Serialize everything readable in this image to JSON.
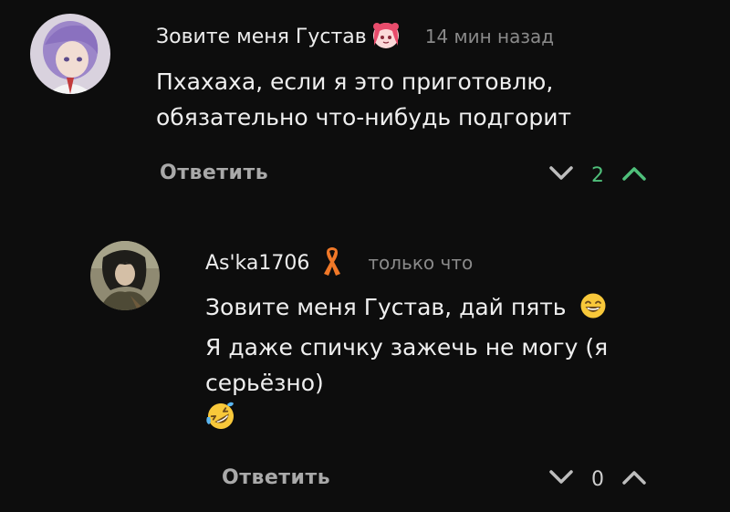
{
  "colors": {
    "background": "#0d0d0d",
    "text_primary": "#efefef",
    "text_muted": "#8a8a8a",
    "score_positive": "#4fbf7a",
    "score_neutral": "#cfcfcf",
    "icon_muted": "#bdbdbd"
  },
  "comments": [
    {
      "username": "Зовите меня Густав",
      "badge_icon": "anime-girl-badge-icon",
      "timestamp": "14 мин назад",
      "body_lines": [
        "Пхахаха, если я это приготовлю,",
        "обязательно что-нибудь подгорит"
      ],
      "reply_label": "Ответить",
      "score": "2"
    },
    {
      "username": "As'ka1706",
      "badge_icon": "awareness-ribbon-icon",
      "timestamp": "только что",
      "body_lines": [
        "Зовите меня Густав, дай пять",
        "Я даже спичку зажечь не могу (я",
        "серьёзно)"
      ],
      "emoji_inline": "grinning-face-emoji",
      "emoji_last": "rolling-on-floor-laughing-emoji",
      "reply_label": "Ответить",
      "score": "0"
    }
  ]
}
